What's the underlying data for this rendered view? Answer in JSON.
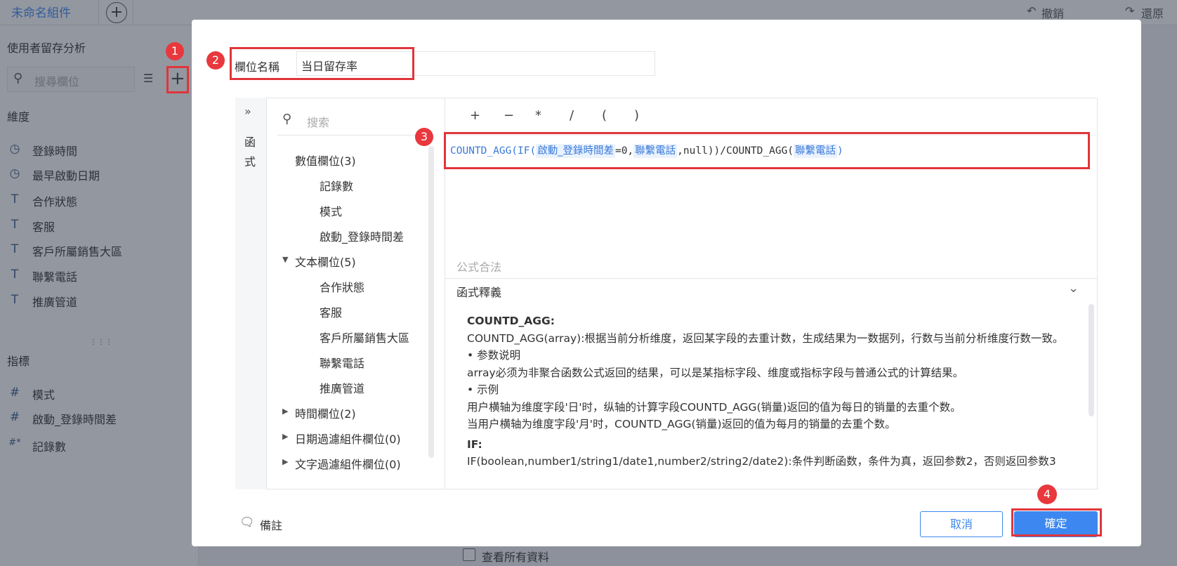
{
  "topbar": {
    "tab_name": "未命名組件",
    "undo_label": "撤銷",
    "redo_label": "還原"
  },
  "sidebar": {
    "dataset_title": "使用者留存分析",
    "search_placeholder": "搜尋欄位",
    "dimensions_label": "維度",
    "dimensions": [
      {
        "icon": "clock-icon",
        "label": "登錄時間"
      },
      {
        "icon": "clock-icon",
        "label": "最早啟動日期"
      },
      {
        "icon": "text-type-icon",
        "label": "合作狀態"
      },
      {
        "icon": "text-type-icon",
        "label": "客服"
      },
      {
        "icon": "text-type-icon",
        "label": "客戶所屬銷售大區"
      },
      {
        "icon": "text-type-icon",
        "label": "聯繫電話"
      },
      {
        "icon": "text-type-icon",
        "label": "推廣管道"
      }
    ],
    "metrics_label": "指標",
    "metrics": [
      {
        "icon": "number-type-icon",
        "label": "模式"
      },
      {
        "icon": "number-type-icon",
        "label": "啟動_登錄時間差"
      },
      {
        "icon": "calculated-number-icon",
        "label": "記錄數"
      }
    ],
    "view_all_label": "查看所有資料"
  },
  "dialog": {
    "field_name_label": "欄位名稱",
    "field_name_value": "当日留存率",
    "fn_tab_label_1": "函",
    "fn_tab_label_2": "式",
    "list_search_placeholder": "搜索",
    "field_groups": [
      {
        "label": "數值欄位(3)",
        "expanded": true,
        "items": [
          "記錄數",
          "模式",
          "啟動_登錄時間差"
        ]
      },
      {
        "label": "文本欄位(5)",
        "expanded": true,
        "items": [
          "合作狀態",
          "客服",
          "客戶所屬銷售大區",
          "聯繫電話",
          "推廣管道"
        ]
      },
      {
        "label": "時間欄位(2)",
        "expanded": false
      },
      {
        "label": "日期過濾組件欄位(0)",
        "expanded": false
      },
      {
        "label": "文字過濾組件欄位(0)",
        "expanded": false
      }
    ],
    "operators": [
      "+",
      "−",
      "*",
      "/",
      "(",
      ")"
    ],
    "formula": {
      "p1": "COUNTD_AGG(IF(",
      "f1": "啟動_登錄時間差",
      "p2": "=0,",
      "f2": "聯繫電話",
      "p3": ",null))/COUNTD_AGG(",
      "f3": "聯繫電話",
      "p4": ")"
    },
    "validity_status": "公式合法",
    "explanation_title": "函式釋義",
    "explanation": [
      {
        "type": "heading",
        "text": "COUNTD_AGG:"
      },
      {
        "type": "text",
        "text": "COUNTD_AGG(array):根据当前分析维度，返回某字段的去重计数，生成结果为一数据列，行数与当前分析维度行数一致。"
      },
      {
        "type": "text",
        "text": "• 参数说明"
      },
      {
        "type": "text",
        "text": "array必须为非聚合函数公式返回的结果，可以是某指标字段、维度或指标字段与普通公式的计算结果。"
      },
      {
        "type": "text",
        "text": "• 示例"
      },
      {
        "type": "text",
        "text": "用户横轴为维度字段'日'时，纵轴的计算字段COUNTD_AGG(销量)返回的值为每日的销量的去重个数。"
      },
      {
        "type": "text",
        "text": "当用户横轴为维度字段'月'时，COUNTD_AGG(销量)返回的值为每月的销量的去重个数。"
      },
      {
        "type": "heading",
        "text": "IF:"
      },
      {
        "type": "text",
        "text": "IF(boolean,number1/string1/date1,number2/string2/date2):条件判断函数，条件为真，返回参数2，否则返回参数3"
      }
    ],
    "note_label": "備註",
    "cancel_label": "取消",
    "confirm_label": "確定"
  },
  "annotations": [
    "1",
    "2",
    "3",
    "4"
  ],
  "colors": {
    "accent": "#3d88f0",
    "annotation_red": "#e8383d",
    "formula_blue": "#3a7ad9"
  }
}
